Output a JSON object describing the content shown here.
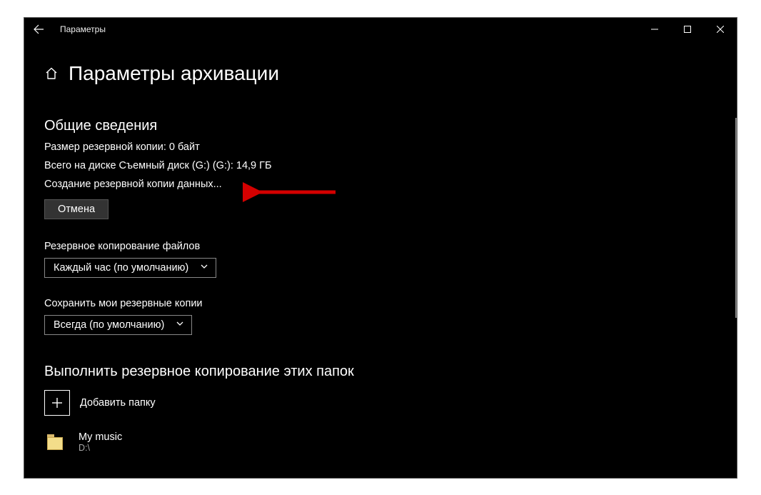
{
  "window": {
    "title": "Параметры"
  },
  "page": {
    "title": "Параметры архивации"
  },
  "overview": {
    "heading": "Общие сведения",
    "size_line": "Размер резервной копии: 0 байт",
    "disk_line": "Всего на диске Съемный диск (G:) (G:): 14,9 ГБ",
    "status_line": "Создание резервной копии данных...",
    "cancel_label": "Отмена"
  },
  "frequency": {
    "label": "Резервное копирование файлов",
    "value": "Каждый час (по умолчанию)"
  },
  "retention": {
    "label": "Сохранить мои резервные копии",
    "value": "Всегда (по умолчанию)"
  },
  "folders": {
    "heading": "Выполнить резервное копирование этих папок",
    "add_label": "Добавить папку",
    "items": [
      {
        "name": "My music",
        "path": "D:\\"
      }
    ]
  }
}
